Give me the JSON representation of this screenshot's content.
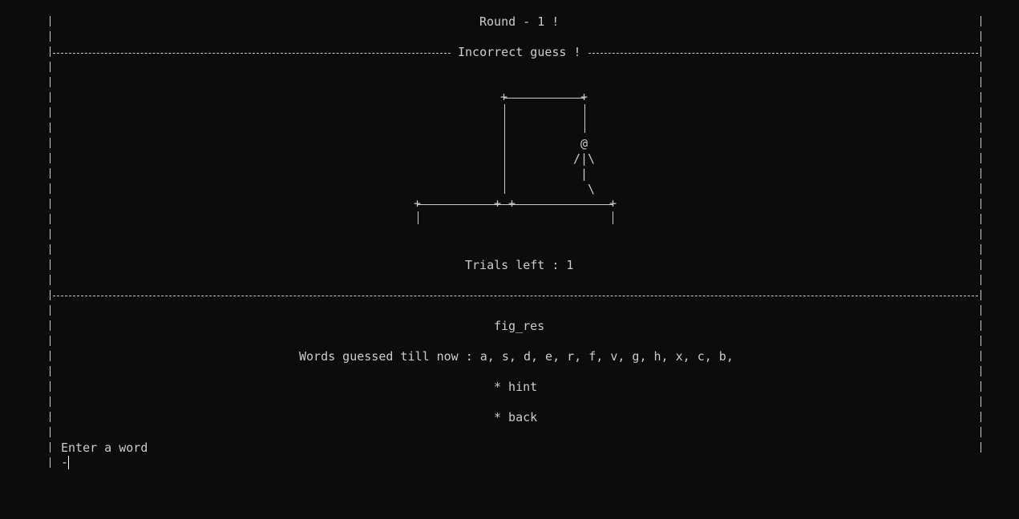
{
  "header": {
    "round_title": "Round - 1 !",
    "status_message": "Incorrect guess !"
  },
  "hangman": {
    "head": "@",
    "arms": "/|\\",
    "body": "|",
    "leg": "\\"
  },
  "trials": {
    "label": "Trials left : 1"
  },
  "game": {
    "masked_word": "fig_res",
    "guessed_label": "Words guessed till now : a, s, d, e, r, f, v, g, h, x, c, b,",
    "hint_option": "* hint",
    "back_option": "* back"
  },
  "prompt": {
    "label": "Enter a word",
    "input_value": "-"
  }
}
